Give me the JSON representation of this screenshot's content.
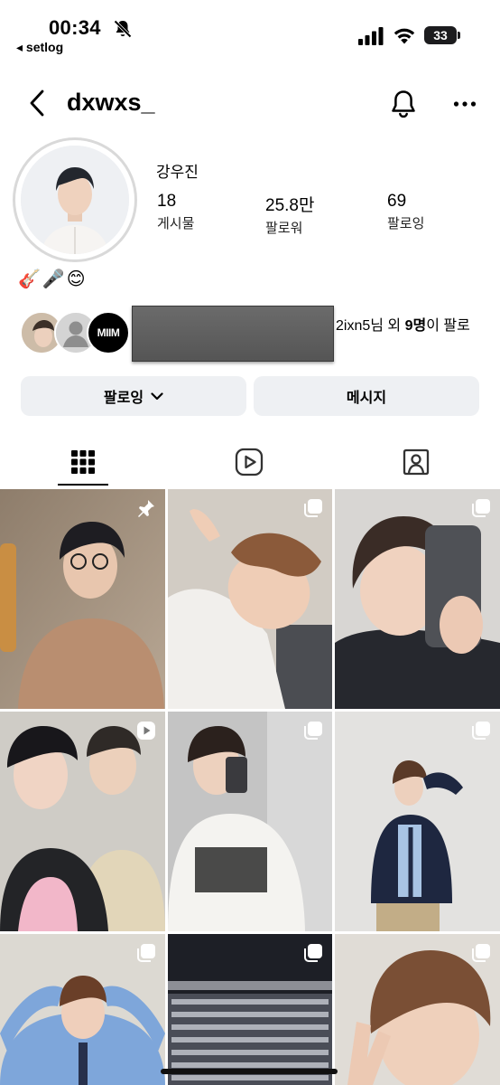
{
  "status_bar": {
    "time": "00:34",
    "back_app": "◂ setlog",
    "battery": "33"
  },
  "header": {
    "username": "dxwxs_"
  },
  "profile": {
    "display_name": "강우진",
    "stats": [
      {
        "value": "18",
        "label": "게시물"
      },
      {
        "value": "25.8만",
        "label": "팔로워"
      },
      {
        "value": "69",
        "label": "팔로잉"
      }
    ],
    "bio": "🎸🎤😊",
    "mutual": {
      "avatar3_text": "MIIM",
      "name": "2ixn5",
      "suffix1": "님 외 ",
      "count": "9명",
      "suffix2": "이 팔로"
    }
  },
  "actions": {
    "following_label": "팔로잉",
    "message_label": "메시지"
  },
  "colors": {
    "button_bg": "#eef0f3",
    "text": "#000000"
  },
  "grid": [
    {
      "badge": "pin-icon",
      "bg": "#9b8a76"
    },
    {
      "badge": "multi-post-icon",
      "bg": "#cfc8bf"
    },
    {
      "badge": "multi-post-icon",
      "bg": "#3a3c43"
    },
    {
      "badge": "reel-icon",
      "bg": "#c9c6c1"
    },
    {
      "badge": "multi-post-icon",
      "bg": "#b9b9b9"
    },
    {
      "badge": "multi-post-icon",
      "bg": "#d8d8d8"
    },
    {
      "badge": "multi-post-icon",
      "bg": "#d9d6cf"
    },
    {
      "badge": "multi-post-icon",
      "bg": "#2b2d33"
    },
    {
      "badge": "multi-post-icon",
      "bg": "#c8b9a8"
    }
  ]
}
